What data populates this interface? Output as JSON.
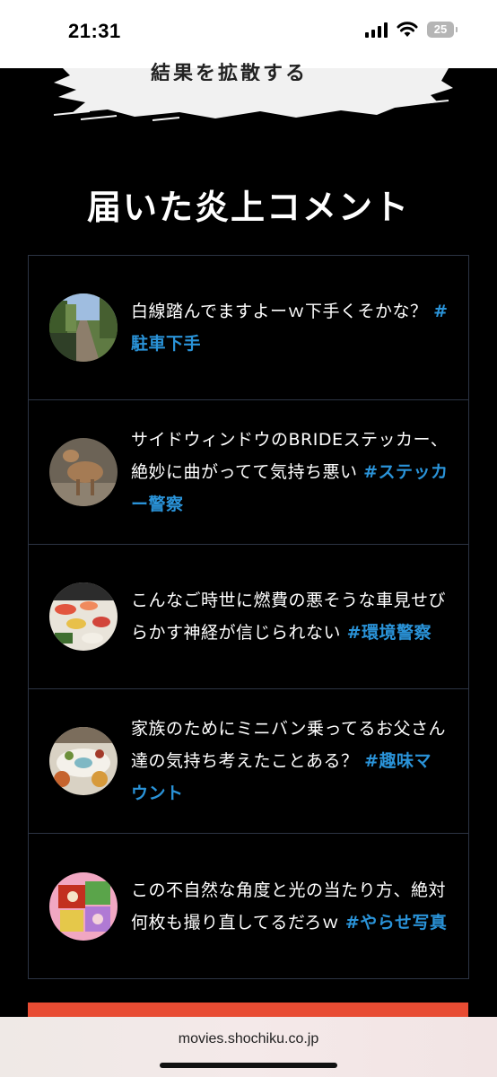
{
  "status_bar": {
    "time": "21:31",
    "battery": "25",
    "icons": [
      "signal-icon",
      "wifi-icon",
      "battery-icon"
    ]
  },
  "banner": {
    "text": "結果を拡散する"
  },
  "section": {
    "title": "届いた炎上コメント"
  },
  "comments": [
    {
      "avatar": "forest-boardwalk-photo",
      "text": "白線踏んでますよーｗ下手くそかな？",
      "hashtag": "#駐車下手"
    },
    {
      "avatar": "deer-photo",
      "text": "サイドウィンドウのBRIDEステッカー、絶妙に曲がってて気持ち悪い",
      "hashtag": "#ステッカー警察"
    },
    {
      "avatar": "sushi-photo",
      "text": "こんなご時世に燃費の悪そうな車見せびらかす神経が信じられない",
      "hashtag": "#環境警察"
    },
    {
      "avatar": "dining-table-photo",
      "text": "家族のためにミニバン乗ってるお父さん達の気持ち考えたことある？",
      "hashtag": "#趣味マウント"
    },
    {
      "avatar": "bento-photo",
      "text": "この不自然な角度と光の当たり方、絶対何枚も撮り直してるだろｗ",
      "hashtag": "#やらせ写真"
    }
  ],
  "browser": {
    "url": "movies.shochiku.co.jp"
  },
  "colors": {
    "hashtag": "#2a93d8",
    "cta": "#e84c33",
    "border": "#2c3444"
  }
}
